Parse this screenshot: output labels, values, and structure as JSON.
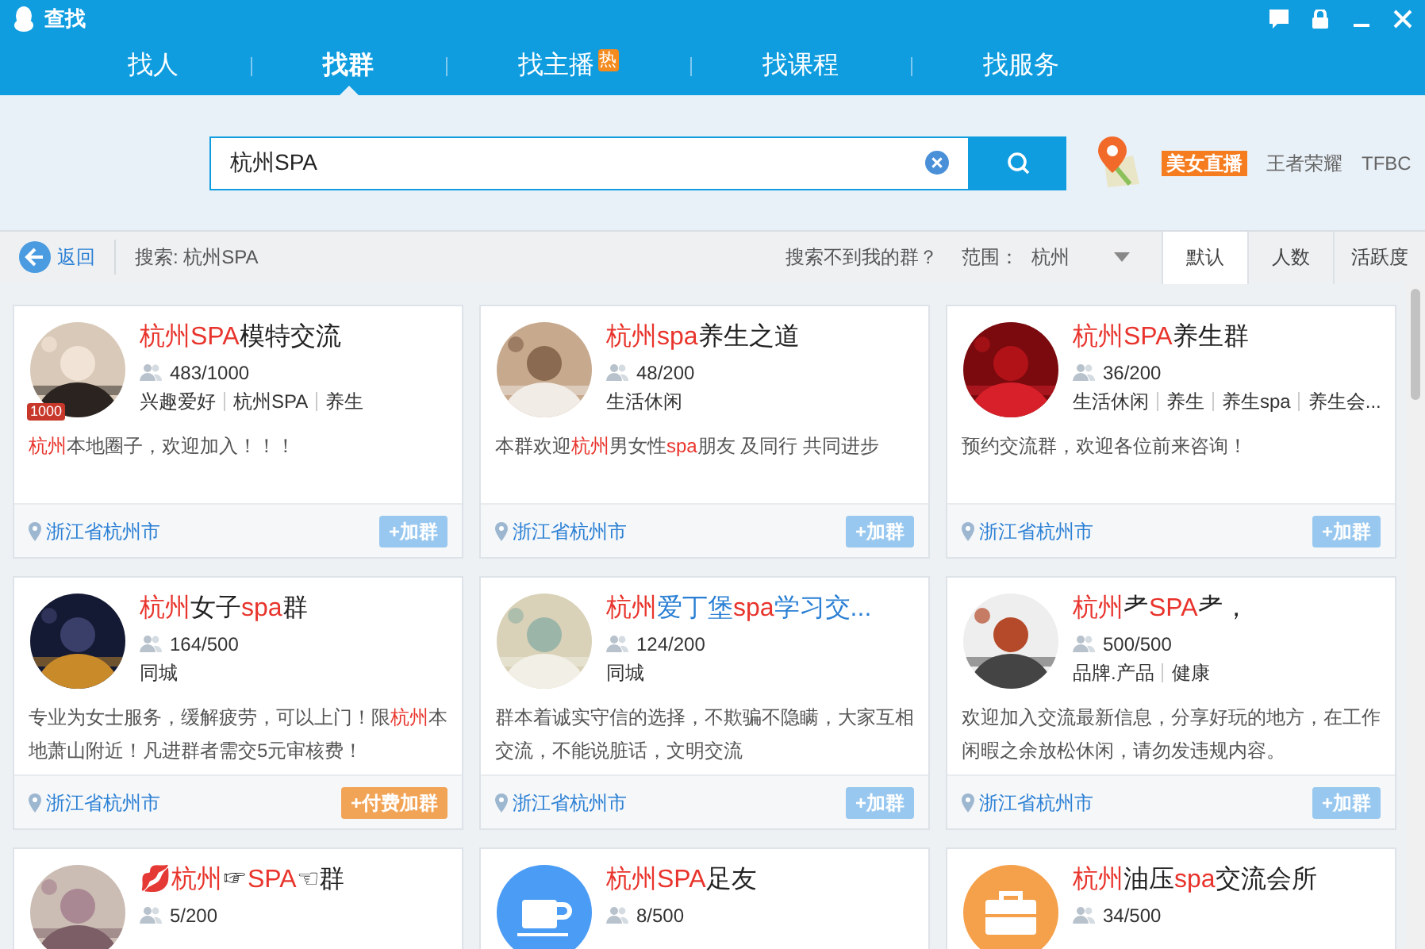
{
  "window": {
    "title": "查找"
  },
  "nav_tabs": [
    {
      "label": "找人",
      "selected": false
    },
    {
      "label": "找群",
      "selected": true
    },
    {
      "label": "找主播",
      "selected": false,
      "badge": "热"
    },
    {
      "label": "找课程",
      "selected": false
    },
    {
      "label": "找服务",
      "selected": false
    }
  ],
  "search": {
    "value": "杭州SPA"
  },
  "hot_links": [
    {
      "label": "美女直播",
      "kind": "highlight"
    },
    {
      "label": "王者荣耀",
      "kind": "plain"
    },
    {
      "label": "TFBC",
      "kind": "plain"
    }
  ],
  "toolbar": {
    "back": "返回",
    "query": "搜索: 杭州SPA",
    "help": "搜索不到我的群？",
    "range_label": "范围：",
    "range_value": "杭州",
    "sort_tabs": [
      {
        "label": "默认",
        "selected": true
      },
      {
        "label": "人数",
        "selected": false
      },
      {
        "label": "活跃度",
        "selected": false
      }
    ]
  },
  "groups": [
    {
      "title": [
        {
          "text": "杭州SPA",
          "color": "#e8342c"
        },
        {
          "text": "模特交流",
          "color": "#222222"
        }
      ],
      "avatar": {
        "kind": "picture",
        "badge": "1000"
      },
      "members": "483/1000",
      "tags": [
        "兴趣爱好",
        "杭州SPA",
        "养生"
      ],
      "description": [
        {
          "text": "杭州",
          "color": "#e8342c"
        },
        {
          "text": "本地圈子，欢迎加入！！！",
          "color": "#555555"
        }
      ],
      "location": "浙江省杭州市",
      "join": {
        "label": "+加群",
        "kind": "free"
      }
    },
    {
      "title": [
        {
          "text": "杭州spa",
          "color": "#e8342c"
        },
        {
          "text": "养生之道",
          "color": "#222222"
        }
      ],
      "avatar": {
        "kind": "picture"
      },
      "members": "48/200",
      "tags": [
        "生活休闲"
      ],
      "description": [
        {
          "text": "本群欢迎",
          "color": "#555555"
        },
        {
          "text": "杭州",
          "color": "#e8342c"
        },
        {
          "text": "男女性",
          "color": "#555555"
        },
        {
          "text": "spa",
          "color": "#e8342c"
        },
        {
          "text": "朋友 及同行 共同进步",
          "color": "#555555"
        }
      ],
      "location": "浙江省杭州市",
      "join": {
        "label": "+加群",
        "kind": "free"
      }
    },
    {
      "title": [
        {
          "text": "杭州SPA",
          "color": "#e8342c"
        },
        {
          "text": "养生群",
          "color": "#222222"
        }
      ],
      "avatar": {
        "kind": "picture"
      },
      "members": "36/200",
      "tags": [
        "生活休闲",
        "养生",
        "养生spa",
        "养生会..."
      ],
      "description": [
        {
          "text": "预约交流群，欢迎各位前来咨询！",
          "color": "#555555"
        }
      ],
      "location": "浙江省杭州市",
      "join": {
        "label": "+加群",
        "kind": "free"
      }
    },
    {
      "title": [
        {
          "text": "杭州",
          "color": "#e8342c"
        },
        {
          "text": "女子",
          "color": "#222222"
        },
        {
          "text": "spa",
          "color": "#e8342c"
        },
        {
          "text": "群",
          "color": "#222222"
        }
      ],
      "avatar": {
        "kind": "picture"
      },
      "members": "164/500",
      "tags": [
        "同城"
      ],
      "description": [
        {
          "text": "专业为女士服务，缓解疲劳，可以上门！限",
          "color": "#555555"
        },
        {
          "text": "杭州",
          "color": "#e8342c"
        },
        {
          "text": "本地萧山附近！凡进群者需交5元审核费！",
          "color": "#555555"
        }
      ],
      "location": "浙江省杭州市",
      "join": {
        "label": "+付费加群",
        "kind": "paid"
      }
    },
    {
      "title": [
        {
          "text": "杭州",
          "color": "#e8342c"
        },
        {
          "text": "爱丁堡",
          "color": "#2a7fd4"
        },
        {
          "text": "spa",
          "color": "#e8342c"
        },
        {
          "text": "学习交...",
          "color": "#2a7fd4"
        }
      ],
      "avatar": {
        "kind": "picture"
      },
      "members": "124/200",
      "tags": [
        "同城"
      ],
      "description": [
        {
          "text": "群本着诚实守信的选择，不欺骗不隐瞒，大家互相交流，不能说脏话，文明交流",
          "color": "#555555"
        }
      ],
      "location": "浙江省杭州市",
      "join": {
        "label": "+加群",
        "kind": "free"
      }
    },
    {
      "title": [
        {
          "text": "杭州",
          "color": "#e8342c"
        },
        {
          "text": "耂",
          "color": "#222222"
        },
        {
          "text": "SPA",
          "color": "#e8342c"
        },
        {
          "text": "耂，",
          "color": "#222222"
        }
      ],
      "avatar": {
        "kind": "picture"
      },
      "members": "500/500",
      "tags": [
        "品牌.产品",
        "健康"
      ],
      "description": [
        {
          "text": "欢迎加入交流最新信息，分享好玩的地方，在工作闲暇之余放松休闲，请勿发违规内容。",
          "color": "#555555"
        }
      ],
      "location": "浙江省杭州市",
      "join": {
        "label": "+加群",
        "kind": "free"
      }
    },
    {
      "title": [
        {
          "text": "💋杭州",
          "color": "#e8342c"
        },
        {
          "text": "☞",
          "color": "#222222"
        },
        {
          "text": "SPA",
          "color": "#e8342c"
        },
        {
          "text": "☜群",
          "color": "#222222"
        }
      ],
      "avatar": {
        "kind": "picture"
      },
      "members": "5/200"
    },
    {
      "title": [
        {
          "text": "杭州SPA",
          "color": "#e8342c"
        },
        {
          "text": "足友",
          "color": "#222222"
        }
      ],
      "avatar": {
        "kind": "cup",
        "color": "#4b9cf5"
      },
      "members": "8/500"
    },
    {
      "title": [
        {
          "text": "杭州",
          "color": "#e8342c"
        },
        {
          "text": "油压",
          "color": "#222222"
        },
        {
          "text": "spa",
          "color": "#e8342c"
        },
        {
          "text": "交流会所",
          "color": "#222222"
        }
      ],
      "avatar": {
        "kind": "briefcase",
        "color": "#f5a14b"
      },
      "members": "34/500"
    }
  ]
}
